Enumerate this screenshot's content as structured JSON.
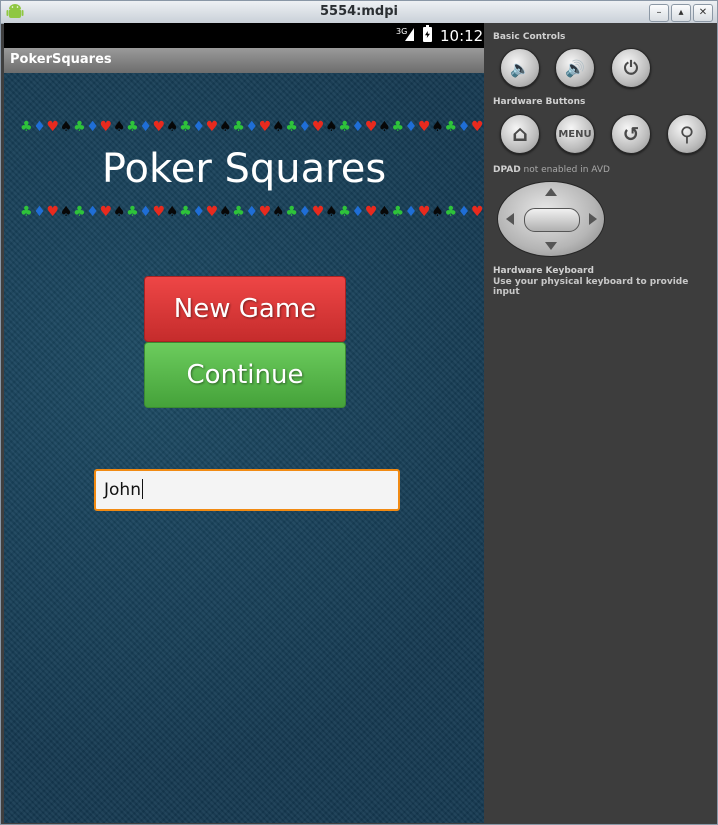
{
  "window": {
    "title": "5554:mdpi",
    "icon": "android-icon",
    "controls": [
      "minimize",
      "maximize",
      "close"
    ]
  },
  "device": {
    "status_bar": {
      "network": "3G",
      "time": "10:12"
    },
    "app_title": "PokerSquares",
    "suits_row": [
      "club",
      "diamond",
      "heart",
      "spade",
      "club",
      "diamond",
      "heart",
      "spade",
      "club",
      "diamond",
      "heart",
      "spade",
      "club",
      "diamond",
      "heart",
      "spade",
      "club",
      "diamond",
      "heart",
      "spade",
      "club",
      "diamond",
      "heart",
      "spade",
      "club",
      "diamond",
      "heart",
      "spade",
      "club",
      "diamond",
      "heart",
      "spade",
      "club",
      "diamond",
      "heart",
      "spade",
      "club"
    ],
    "game_title": "Poker Squares",
    "buttons": {
      "new_game": "New Game",
      "continue": "Continue"
    },
    "name_field": {
      "value": "John"
    },
    "colors": {
      "felt": "#163a52",
      "new_game": "#d93a3a",
      "continue": "#57b64a",
      "input_focus": "#f18a12",
      "club": "#2ec33a",
      "diamond": "#1f6ed6",
      "heart": "#e82a1e",
      "spade": "#070707"
    }
  },
  "emulator_panel": {
    "basic_controls_label": "Basic Controls",
    "basic_controls": [
      {
        "name": "volume-down-icon",
        "glyph": "🔈"
      },
      {
        "name": "volume-up-icon",
        "glyph": "🔊"
      },
      {
        "name": "power-icon",
        "glyph": "⏻"
      }
    ],
    "hardware_buttons_label": "Hardware Buttons",
    "hardware_buttons": {
      "home_icon": "⌂",
      "menu": "MENU",
      "back_icon": "↺",
      "search_icon": "⚲"
    },
    "dpad_label_bold": "DPAD",
    "dpad_label_rest": " not enabled in AVD",
    "keyboard_label": "Hardware Keyboard",
    "keyboard_hint": "Use your physical keyboard to provide input"
  }
}
